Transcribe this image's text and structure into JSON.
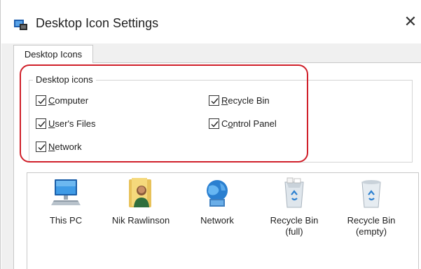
{
  "window": {
    "title": "Desktop Icon Settings",
    "close_glyph": "✕"
  },
  "tab": {
    "label": "Desktop Icons"
  },
  "group": {
    "label": "Desktop icons",
    "checkboxes": [
      {
        "label": "Computer",
        "accesskey": "C",
        "rest": "omputer",
        "checked": true
      },
      {
        "label": "User's Files",
        "accesskey": "U",
        "rest": "ser's Files",
        "checked": true
      },
      {
        "label": "Network",
        "accesskey": "N",
        "rest": "etwork",
        "checked": true
      },
      {
        "label": "Recycle Bin",
        "accesskey": "R",
        "rest": "ecycle Bin",
        "checked": true
      },
      {
        "label": "Control Panel",
        "pre": "C",
        "accesskey": "o",
        "rest": "ntrol Panel",
        "checked": true
      }
    ]
  },
  "icons": [
    {
      "label": "This PC",
      "icon": "computer-icon"
    },
    {
      "label": "Nik Rawlinson",
      "icon": "user-folder-icon"
    },
    {
      "label": "Network",
      "icon": "network-icon"
    },
    {
      "label_line1": "Recycle Bin",
      "label_line2": "(full)",
      "icon": "recycle-bin-full-icon"
    },
    {
      "label_line1": "Recycle Bin",
      "label_line2": "(empty)",
      "icon": "recycle-bin-empty-icon"
    }
  ],
  "colors": {
    "highlight": "#d0202a",
    "dialog_bg": "#f0f0f0",
    "accent_blue": "#1e73c9"
  }
}
